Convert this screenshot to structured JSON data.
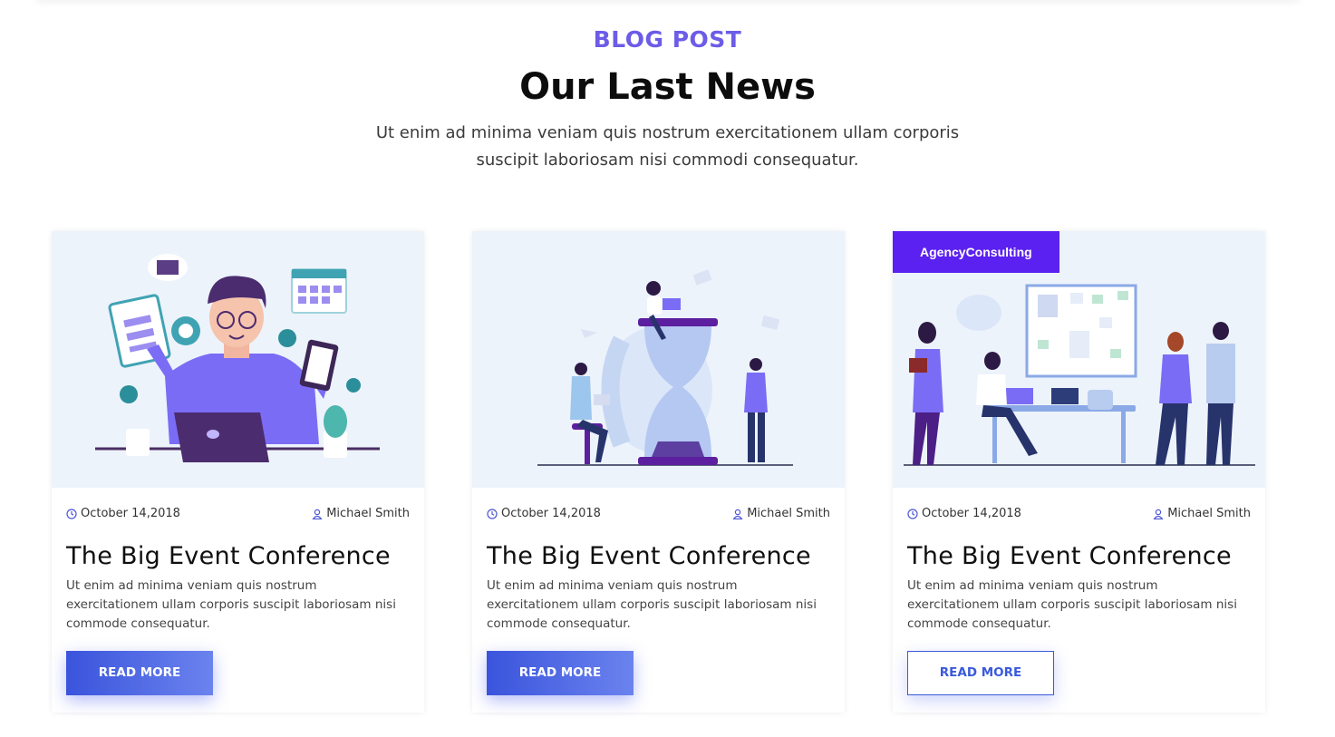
{
  "section": {
    "kicker": "BLOG POST",
    "title": "Our Last News",
    "intro": "Ut enim ad minima veniam quis nostrum exercitationem ullam corporis suscipit laboriosam nisi commodi consequatur."
  },
  "cards": [
    {
      "tag": "",
      "date": "October 14,2018",
      "author": "Michael Smith",
      "title": "The Big Event Conference",
      "excerpt": "Ut enim ad minima veniam quis nostrum exercitationem ullam corporis suscipit laboriosam nisi commode consequatur.",
      "button": "READ MORE",
      "button_style": "solid",
      "illustration": "developer-with-laptop-illustration"
    },
    {
      "tag": "",
      "date": "October 14,2018",
      "author": "Michael Smith",
      "title": "The Big Event Conference",
      "excerpt": "Ut enim ad minima veniam quis nostrum exercitationem ullam corporis suscipit laboriosam nisi commode consequatur.",
      "button": "READ MORE",
      "button_style": "solid",
      "illustration": "hourglass-team-illustration"
    },
    {
      "tag": "AgencyConsulting",
      "date": "October 14,2018",
      "author": "Michael Smith",
      "title": "The Big Event Conference",
      "excerpt": "Ut enim ad minima veniam quis nostrum exercitationem ullam corporis suscipit laboriosam nisi commode consequatur.",
      "button": "READ MORE",
      "button_style": "outline",
      "illustration": "office-meeting-illustration"
    }
  ],
  "colors": {
    "accent": "#6c5ce7",
    "tag_bg": "#5b21f0",
    "button": "#3a54dc",
    "image_bg": "#edf3fb"
  }
}
